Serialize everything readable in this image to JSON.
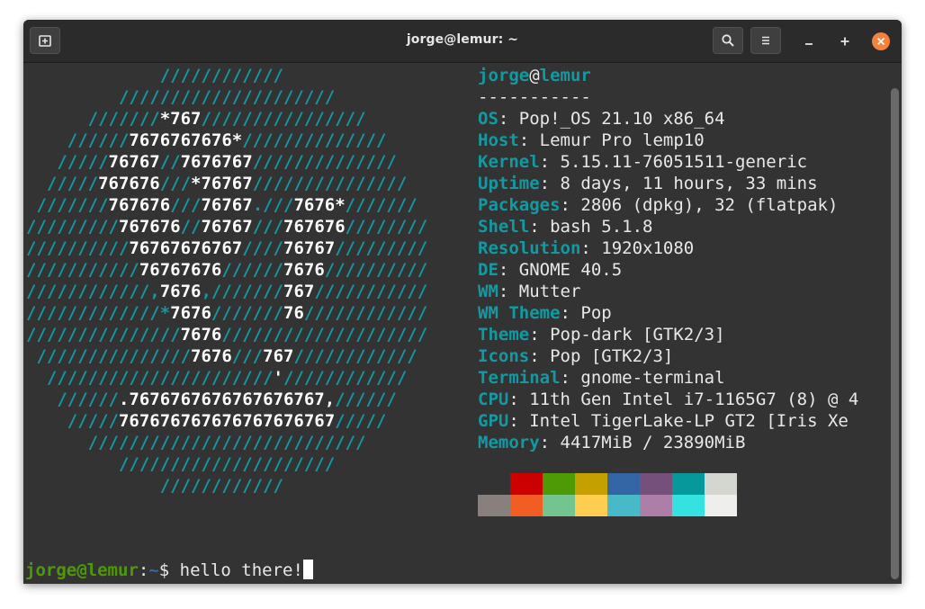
{
  "window": {
    "title": "jorge@lemur: ~",
    "buttons": {
      "new_tab": "new-tab-icon",
      "search": "search-icon",
      "menu": "hamburger-menu-icon",
      "minimize": "minimize-icon",
      "maximize": "maximize-icon",
      "close": "close-icon"
    }
  },
  "neofetch": {
    "ascii_logo": [
      [
        {
          "t": "             ////////////"
        }
      ],
      [
        {
          "t": "         /////////////////////"
        }
      ],
      [
        {
          "t": "      ///////"
        },
        {
          "t": "*767",
          "w": true
        },
        {
          "t": "////////////////"
        }
      ],
      [
        {
          "t": "    //////"
        },
        {
          "t": "7676767676*",
          "w": true
        },
        {
          "t": "//////////////"
        }
      ],
      [
        {
          "t": "   /////"
        },
        {
          "t": "76767",
          "w": true
        },
        {
          "t": "//"
        },
        {
          "t": "7676767",
          "w": true
        },
        {
          "t": "//////////////"
        }
      ],
      [
        {
          "t": "  /////"
        },
        {
          "t": "767676",
          "w": true
        },
        {
          "t": "///"
        },
        {
          "t": "*76767",
          "w": true
        },
        {
          "t": "///////////////"
        }
      ],
      [
        {
          "t": " ///////"
        },
        {
          "t": "767676",
          "w": true
        },
        {
          "t": "///"
        },
        {
          "t": "76767",
          "w": true
        },
        {
          "t": ".///"
        },
        {
          "t": "7676*",
          "w": true
        },
        {
          "t": "///////"
        }
      ],
      [
        {
          "t": "/////////"
        },
        {
          "t": "767676",
          "w": true
        },
        {
          "t": "//"
        },
        {
          "t": "76767",
          "w": true
        },
        {
          "t": "///"
        },
        {
          "t": "767676",
          "w": true
        },
        {
          "t": "////////"
        }
      ],
      [
        {
          "t": "//////////"
        },
        {
          "t": "76767676767",
          "w": true
        },
        {
          "t": "////"
        },
        {
          "t": "76767",
          "w": true
        },
        {
          "t": "/////////"
        }
      ],
      [
        {
          "t": "///////////"
        },
        {
          "t": "76767676",
          "w": true
        },
        {
          "t": "//////"
        },
        {
          "t": "7676",
          "w": true
        },
        {
          "t": "//////////"
        }
      ],
      [
        {
          "t": "////////////,"
        },
        {
          "t": "7676",
          "w": true
        },
        {
          "t": ",///////"
        },
        {
          "t": "767",
          "w": true
        },
        {
          "t": "///////////"
        }
      ],
      [
        {
          "t": "/////////////*"
        },
        {
          "t": "7676",
          "w": true
        },
        {
          "t": "///////"
        },
        {
          "t": "76",
          "w": true
        },
        {
          "t": "////////////"
        }
      ],
      [
        {
          "t": "///////////////"
        },
        {
          "t": "7676",
          "w": true
        },
        {
          "t": "////////////////////"
        }
      ],
      [
        {
          "t": " ///////////////"
        },
        {
          "t": "7676",
          "w": true
        },
        {
          "t": "///"
        },
        {
          "t": "767",
          "w": true
        },
        {
          "t": "////////////"
        }
      ],
      [
        {
          "t": "  //////////////////////"
        },
        {
          "t": "'",
          "w": true
        },
        {
          "t": "////////////"
        }
      ],
      [
        {
          "t": "   //////"
        },
        {
          "t": ".7676767676767676767,",
          "w": true
        },
        {
          "t": "//////"
        }
      ],
      [
        {
          "t": "    /////"
        },
        {
          "t": "767676767676767676767",
          "w": true
        },
        {
          "t": "/////"
        }
      ],
      [
        {
          "t": "      ///////////////////////////"
        }
      ],
      [
        {
          "t": "         /////////////////////"
        }
      ],
      [
        {
          "t": "             ////////////"
        }
      ]
    ],
    "user": "jorge",
    "at": "@",
    "host": "lemur",
    "separator": "-----------",
    "fields": [
      {
        "key": "OS",
        "value": "Pop!_OS 21.10 x86_64"
      },
      {
        "key": "Host",
        "value": "Lemur Pro lemp10"
      },
      {
        "key": "Kernel",
        "value": "5.15.11-76051511-generic"
      },
      {
        "key": "Uptime",
        "value": "8 days, 11 hours, 33 mins"
      },
      {
        "key": "Packages",
        "value": "2806 (dpkg), 32 (flatpak)"
      },
      {
        "key": "Shell",
        "value": "bash 5.1.8"
      },
      {
        "key": "Resolution",
        "value": "1920x1080"
      },
      {
        "key": "DE",
        "value": "GNOME 40.5"
      },
      {
        "key": "WM",
        "value": "Mutter"
      },
      {
        "key": "WM Theme",
        "value": "Pop"
      },
      {
        "key": "Theme",
        "value": "Pop-dark [GTK2/3]"
      },
      {
        "key": "Icons",
        "value": "Pop [GTK2/3]"
      },
      {
        "key": "Terminal",
        "value": "gnome-terminal"
      },
      {
        "key": "CPU",
        "value": "11th Gen Intel i7-1165G7 (8) @ 4"
      },
      {
        "key": "GPU",
        "value": "Intel TigerLake-LP GT2 [Iris Xe"
      },
      {
        "key": "Memory",
        "value": "4417MiB / 23890MiB"
      }
    ],
    "palette_top": [
      "#333333",
      "#cc0000",
      "#4e9a06",
      "#c4a000",
      "#3465a4",
      "#75507b",
      "#06989a",
      "#d3d7cf"
    ],
    "palette_bottom": [
      "#88807c",
      "#f15d22",
      "#73c48f",
      "#ffce51",
      "#48b9c7",
      "#ad7fa8",
      "#34e2e2",
      "#eeeeec"
    ]
  },
  "prompt": {
    "user_host": "jorge@lemur",
    "colon": ":",
    "path": "~",
    "symbol": "$ ",
    "command": "hello there!"
  }
}
